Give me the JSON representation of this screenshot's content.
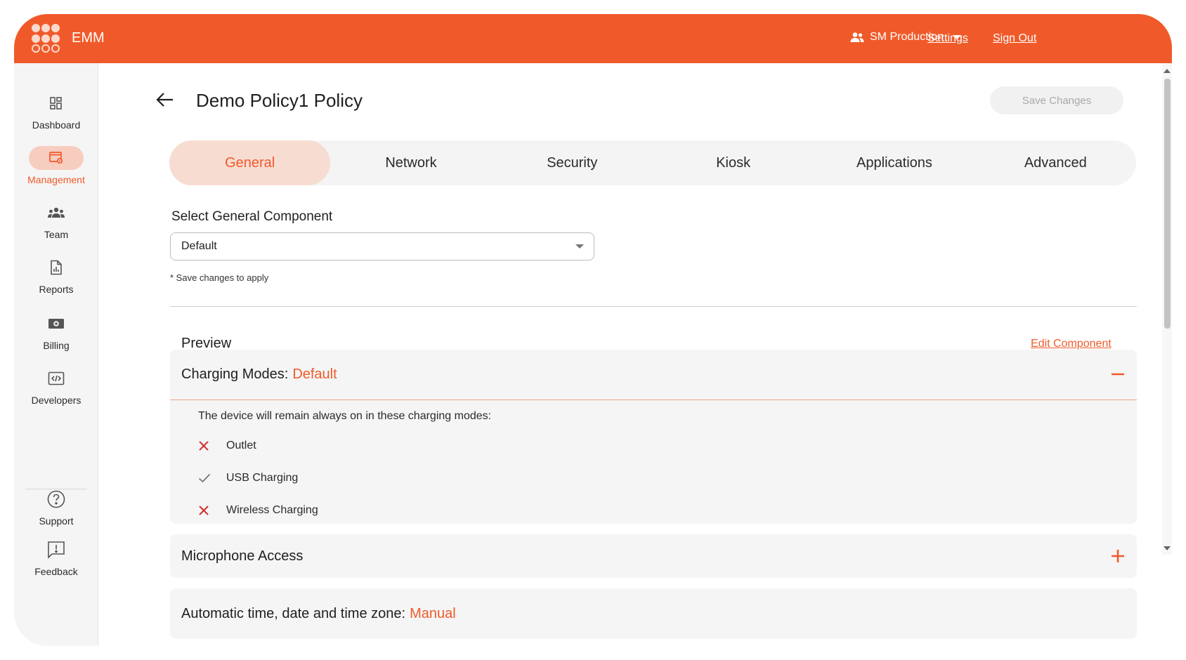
{
  "app": {
    "brand": "EMM"
  },
  "header": {
    "org_name": "SM Production",
    "settings_label": "Settings",
    "signout_label": "Sign Out"
  },
  "sidebar": {
    "items": [
      {
        "label": "Dashboard",
        "icon": "dashboard-icon"
      },
      {
        "label": "Management",
        "icon": "management-icon",
        "active": true
      },
      {
        "label": "Team",
        "icon": "team-icon"
      },
      {
        "label": "Reports",
        "icon": "reports-icon"
      },
      {
        "label": "Billing",
        "icon": "billing-icon"
      },
      {
        "label": "Developers",
        "icon": "developers-icon"
      }
    ],
    "bottom": [
      {
        "label": "Support",
        "icon": "help-icon"
      },
      {
        "label": "Feedback",
        "icon": "feedback-icon"
      }
    ]
  },
  "page": {
    "title": "Demo Policy1 Policy",
    "save_label": "Save Changes"
  },
  "tabs": [
    "General",
    "Network",
    "Security",
    "Kiosk",
    "Applications",
    "Advanced"
  ],
  "active_tab": "General",
  "component": {
    "label": "Select General Component",
    "selected": "Default",
    "hint": "* Save changes to apply"
  },
  "preview": {
    "label": "Preview",
    "edit_label": "Edit Component",
    "cards": [
      {
        "title": "Charging Modes:",
        "value": "Default",
        "expanded": true,
        "description": "The device will remain always on in these charging modes:",
        "options": [
          {
            "label": "Outlet",
            "enabled": false
          },
          {
            "label": "USB Charging",
            "enabled": true
          },
          {
            "label": "Wireless Charging",
            "enabled": false
          }
        ]
      },
      {
        "title": "Microphone Access",
        "value": "",
        "expanded": false
      },
      {
        "title": "Automatic time, date and time zone:",
        "value": "Manual",
        "expanded": false
      }
    ]
  },
  "colors": {
    "accent": "#f05a2a",
    "accent_light": "#f7dcd2",
    "cross": "#d32f2f",
    "check": "#777777"
  }
}
